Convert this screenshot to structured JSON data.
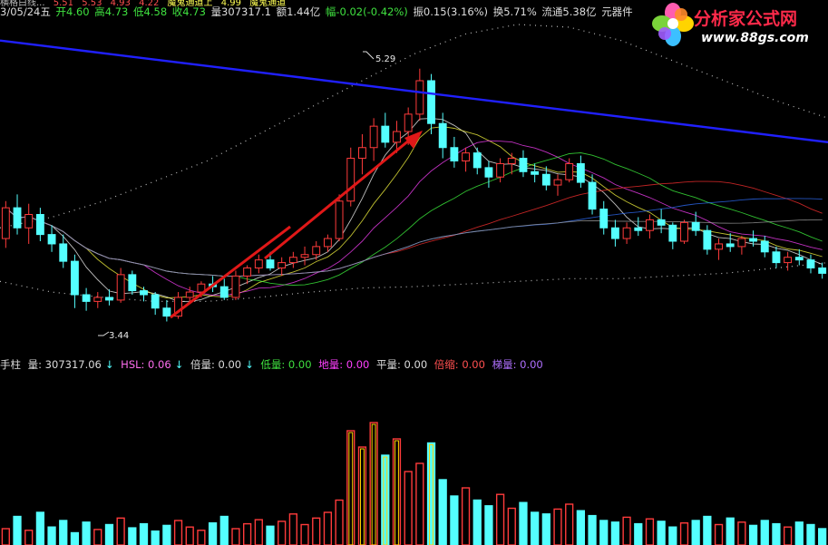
{
  "top_info": [
    "横格白线...",
    "5.51",
    "5.53",
    "4.93",
    "4.22",
    "魔鬼通道上",
    "4.99",
    "魔鬼通道"
  ],
  "quote": {
    "date": "3/05/24五",
    "open": "开4.60",
    "high": "高4.73",
    "low": "低4.58",
    "close": "收4.73",
    "volume": "量307317.1",
    "amount": "额1.44亿",
    "change": "幅-0.02(-0.42%)",
    "amplitude": "振0.15(3.16%)",
    "turnover": "换5.71%",
    "float": "流通5.38亿",
    "sector": "元器件"
  },
  "logo": {
    "title": "分析家公式网",
    "url": "www.88gs.com"
  },
  "price_labels": {
    "high": "5.29",
    "low": "3.44"
  },
  "volume_legend": {
    "label": "手柱",
    "vol": "量: 307317.06",
    "vol_arrow": "↓",
    "hsl": "HSL: 0.06",
    "hsl_arrow": "↓",
    "bei": "倍量: 0.00",
    "bei_arrow": "↓",
    "di": "低量: 0.00",
    "diliang": "地量: 0.00",
    "ping": "平量: 0.00",
    "suo": "倍缩: 0.00",
    "ti": "梯量: 0.00"
  },
  "colors": {
    "up": "#ff3b3b",
    "down": "#54ffff",
    "ma_blue": "#2020ff",
    "arrow": "#e01818"
  },
  "chart_data": {
    "type": "candlestick",
    "ylim": [
      3.2,
      5.6
    ],
    "candles": [
      [
        4.02,
        4.3,
        3.95,
        4.25
      ],
      [
        4.25,
        4.35,
        4.05,
        4.1
      ],
      [
        4.1,
        4.28,
        3.98,
        4.2
      ],
      [
        4.2,
        4.25,
        4.0,
        4.05
      ],
      [
        4.05,
        4.12,
        3.92,
        3.98
      ],
      [
        3.98,
        4.05,
        3.8,
        3.85
      ],
      [
        3.85,
        3.9,
        3.5,
        3.6
      ],
      [
        3.6,
        3.65,
        3.48,
        3.55
      ],
      [
        3.55,
        3.62,
        3.5,
        3.58
      ],
      [
        3.58,
        3.64,
        3.52,
        3.56
      ],
      [
        3.56,
        3.8,
        3.54,
        3.75
      ],
      [
        3.75,
        3.78,
        3.6,
        3.63
      ],
      [
        3.63,
        3.66,
        3.55,
        3.6
      ],
      [
        3.6,
        3.62,
        3.45,
        3.5
      ],
      [
        3.5,
        3.56,
        3.4,
        3.44
      ],
      [
        3.44,
        3.62,
        3.42,
        3.58
      ],
      [
        3.58,
        3.66,
        3.54,
        3.62
      ],
      [
        3.62,
        3.7,
        3.58,
        3.68
      ],
      [
        3.68,
        3.74,
        3.62,
        3.66
      ],
      [
        3.66,
        3.72,
        3.56,
        3.58
      ],
      [
        3.58,
        3.78,
        3.56,
        3.74
      ],
      [
        3.74,
        3.82,
        3.68,
        3.8
      ],
      [
        3.8,
        3.9,
        3.76,
        3.86
      ],
      [
        3.86,
        3.92,
        3.78,
        3.8
      ],
      [
        3.8,
        3.88,
        3.74,
        3.84
      ],
      [
        3.84,
        3.92,
        3.8,
        3.88
      ],
      [
        3.88,
        3.96,
        3.82,
        3.9
      ],
      [
        3.9,
        4.0,
        3.86,
        3.96
      ],
      [
        3.96,
        4.05,
        3.92,
        4.02
      ],
      [
        4.02,
        4.35,
        4.0,
        4.3
      ],
      [
        4.3,
        4.7,
        4.26,
        4.62
      ],
      [
        4.62,
        4.8,
        4.5,
        4.7
      ],
      [
        4.7,
        4.92,
        4.6,
        4.86
      ],
      [
        4.86,
        4.96,
        4.7,
        4.74
      ],
      [
        4.74,
        4.9,
        4.66,
        4.82
      ],
      [
        4.82,
        5.0,
        4.72,
        4.95
      ],
      [
        4.95,
        5.29,
        4.9,
        5.2
      ],
      [
        5.2,
        5.25,
        4.8,
        4.88
      ],
      [
        4.88,
        4.96,
        4.62,
        4.7
      ],
      [
        4.7,
        4.78,
        4.55,
        4.6
      ],
      [
        4.6,
        4.7,
        4.52,
        4.66
      ],
      [
        4.66,
        4.7,
        4.5,
        4.55
      ],
      [
        4.55,
        4.6,
        4.4,
        4.48
      ],
      [
        4.48,
        4.62,
        4.44,
        4.58
      ],
      [
        4.58,
        4.66,
        4.5,
        4.62
      ],
      [
        4.62,
        4.68,
        4.48,
        4.52
      ],
      [
        4.52,
        4.58,
        4.44,
        4.5
      ],
      [
        4.5,
        4.56,
        4.38,
        4.42
      ],
      [
        4.42,
        4.5,
        4.34,
        4.46
      ],
      [
        4.46,
        4.62,
        4.44,
        4.58
      ],
      [
        4.58,
        4.64,
        4.4,
        4.44
      ],
      [
        4.44,
        4.5,
        4.2,
        4.24
      ],
      [
        4.24,
        4.3,
        4.05,
        4.1
      ],
      [
        4.1,
        4.16,
        3.96,
        4.02
      ],
      [
        4.02,
        4.14,
        3.98,
        4.1
      ],
      [
        4.1,
        4.18,
        4.04,
        4.08
      ],
      [
        4.08,
        4.2,
        4.02,
        4.16
      ],
      [
        4.16,
        4.24,
        4.06,
        4.12
      ],
      [
        4.12,
        4.14,
        3.94,
        4.0
      ],
      [
        4.0,
        4.16,
        3.98,
        4.14
      ],
      [
        4.14,
        4.22,
        4.04,
        4.08
      ],
      [
        4.08,
        4.12,
        3.9,
        3.94
      ],
      [
        3.94,
        4.02,
        3.86,
        3.98
      ],
      [
        3.98,
        4.06,
        3.92,
        3.96
      ],
      [
        3.96,
        4.04,
        3.9,
        4.02
      ],
      [
        4.02,
        4.08,
        3.96,
        4.0
      ],
      [
        4.0,
        4.04,
        3.88,
        3.92
      ],
      [
        3.92,
        3.96,
        3.8,
        3.84
      ],
      [
        3.84,
        3.92,
        3.78,
        3.88
      ],
      [
        3.88,
        3.94,
        3.82,
        3.86
      ],
      [
        3.86,
        3.9,
        3.76,
        3.8
      ],
      [
        3.8,
        3.84,
        3.72,
        3.76
      ]
    ],
    "volumes": [
      20,
      35,
      18,
      40,
      22,
      30,
      15,
      28,
      19,
      25,
      33,
      21,
      26,
      17,
      24,
      30,
      22,
      18,
      27,
      35,
      20,
      26,
      31,
      23,
      29,
      38,
      25,
      33,
      40,
      55,
      140,
      120,
      150,
      110,
      130,
      90,
      100,
      125,
      80,
      60,
      70,
      55,
      48,
      62,
      45,
      52,
      40,
      38,
      44,
      50,
      42,
      36,
      30,
      28,
      34,
      26,
      32,
      29,
      22,
      27,
      30,
      35,
      25,
      33,
      28,
      24,
      30,
      26,
      22,
      28,
      25,
      20
    ],
    "ma_blue": [
      5.5,
      5.46,
      5.42,
      5.38,
      5.34,
      5.3,
      5.26,
      5.22,
      5.18,
      5.14,
      5.1,
      5.06,
      5.02,
      4.98,
      4.94,
      4.9,
      4.86,
      4.82,
      4.78,
      4.74
    ],
    "dotted_upper": [
      4.1,
      4.18,
      4.3,
      4.45,
      4.6,
      4.8,
      5.0,
      5.2,
      5.4,
      5.55,
      5.62,
      5.6,
      5.5,
      5.35,
      5.2,
      5.05,
      4.92
    ],
    "dotted_lower": [
      3.7,
      3.62,
      3.58,
      3.55,
      3.55,
      3.58,
      3.62,
      3.65,
      3.66,
      3.68,
      3.7,
      3.72,
      3.72,
      3.74,
      3.76,
      3.8,
      3.84
    ]
  }
}
